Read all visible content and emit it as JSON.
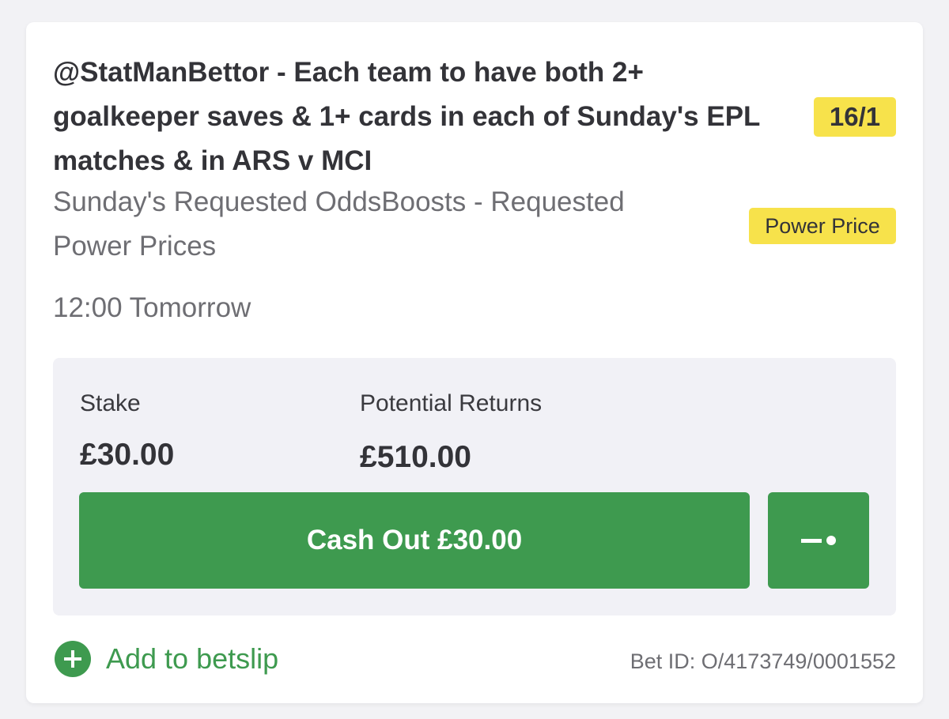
{
  "bet": {
    "title": "@StatManBettor - Each team to have both 2+ goalkeeper saves & 1+ cards in each of Sunday's EPL matches & in ARS v MCI",
    "odds": "16/1",
    "market": "Sunday's Requested OddsBoosts - Requested Power Prices",
    "price_badge": "Power Price",
    "time": "12:00 Tomorrow"
  },
  "panel": {
    "stake_label": "Stake",
    "stake_value": "£30.00",
    "returns_label": "Potential Returns",
    "returns_value": "£510.00",
    "cashout_label": "Cash Out £30.00"
  },
  "footer": {
    "add_label": "Add to betslip",
    "bet_id": "Bet ID: O/4173749/0001552"
  },
  "colors": {
    "accent_green": "#3e9a4f",
    "badge_yellow": "#f7e24b",
    "panel_bg": "#f1f1f6"
  },
  "icons": {
    "partial_cashout": "slider-icon",
    "add": "plus-circle-icon"
  }
}
